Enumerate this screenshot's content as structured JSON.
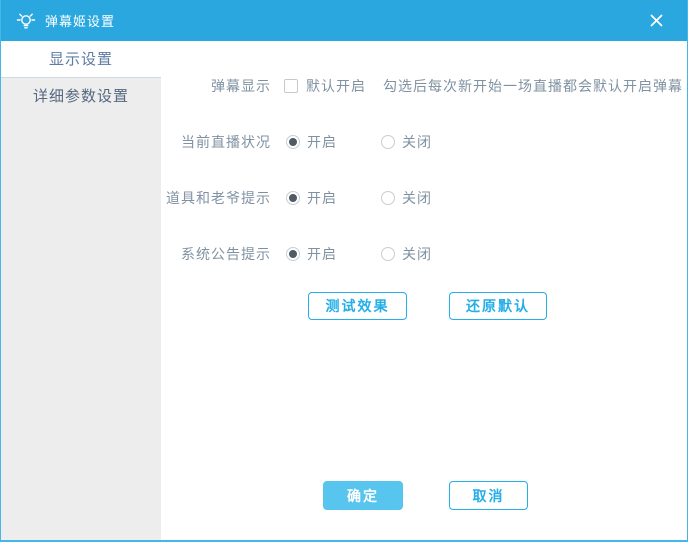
{
  "titlebar": {
    "title": "弹幕姬设置",
    "icons": {
      "app": "lightbulb-icon",
      "close": "close-icon"
    }
  },
  "sidebar": {
    "items": [
      {
        "label": "显示设置",
        "active": true
      },
      {
        "label": "详细参数设置",
        "active": false
      }
    ]
  },
  "main": {
    "danmaku_display": {
      "label": "弹幕显示",
      "checkbox_label": "默认开启",
      "checked": false,
      "hint": "勾选后每次新开始一场直播都会默认开启弹幕"
    },
    "radio_rows": [
      {
        "label": "当前直播状况",
        "options": [
          "开启",
          "关闭"
        ],
        "selected": "开启"
      },
      {
        "label": "道具和老爷提示",
        "options": [
          "开启",
          "关闭"
        ],
        "selected": "开启"
      },
      {
        "label": "系统公告提示",
        "options": [
          "开启",
          "关闭"
        ],
        "selected": "开启"
      }
    ],
    "action_buttons": [
      {
        "label": "测试效果"
      },
      {
        "label": "还原默认"
      }
    ]
  },
  "footer": {
    "confirm_label": "确定",
    "cancel_label": "取消"
  },
  "colors": {
    "titlebar": "#2aa7df",
    "border": "#43b7e8",
    "sidebar_bg": "#ededed",
    "accent": "#25aee8",
    "confirm_bg": "#57c5ee",
    "text": "#8092a2"
  }
}
